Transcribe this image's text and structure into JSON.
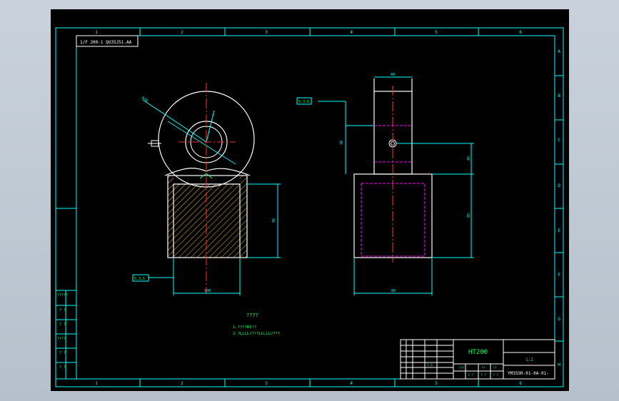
{
  "drawing": {
    "title_note": "1/F 200-1 QU35J51.AA",
    "material": "HT200",
    "part_number": "YM35SR-01-0A-01-",
    "scale_label": "1:2",
    "notes_heading": "????",
    "note_line_1": "1.????R5??",
    "note_line_2": "2.?LLLL????LLLLL????",
    "tag_left": "5.3.5",
    "tag_right": "5.3.6",
    "column_zones": [
      "1",
      "2",
      "3",
      "4",
      "5",
      "6"
    ],
    "row_zones": [
      "A",
      "B",
      "C",
      "D",
      "E",
      "F",
      "G",
      "H"
    ],
    "side_table": [
      "?????",
      "? ?",
      "? ?",
      "????",
      "? ?",
      "? ?"
    ],
    "title_block_small": [
      "????",
      "??",
      "??",
      "? ?",
      "? ?",
      "? ?",
      "1:1"
    ],
    "dims": {
      "front_bottom_width": "100",
      "front_body_height": "95",
      "side_top_width": "40",
      "side_upper_height": "30",
      "side_lower_height": "85",
      "side_bottom_width": "80",
      "side_hole_height": "45",
      "radius": "R70"
    }
  },
  "colors": {
    "background": "#000000",
    "frame": "#00ffff",
    "outline": "#ffffff",
    "centerline": "#ff2b2b",
    "hidden": "#ff00ff",
    "hatch": "#ffcc00",
    "text": "#00ff66"
  }
}
